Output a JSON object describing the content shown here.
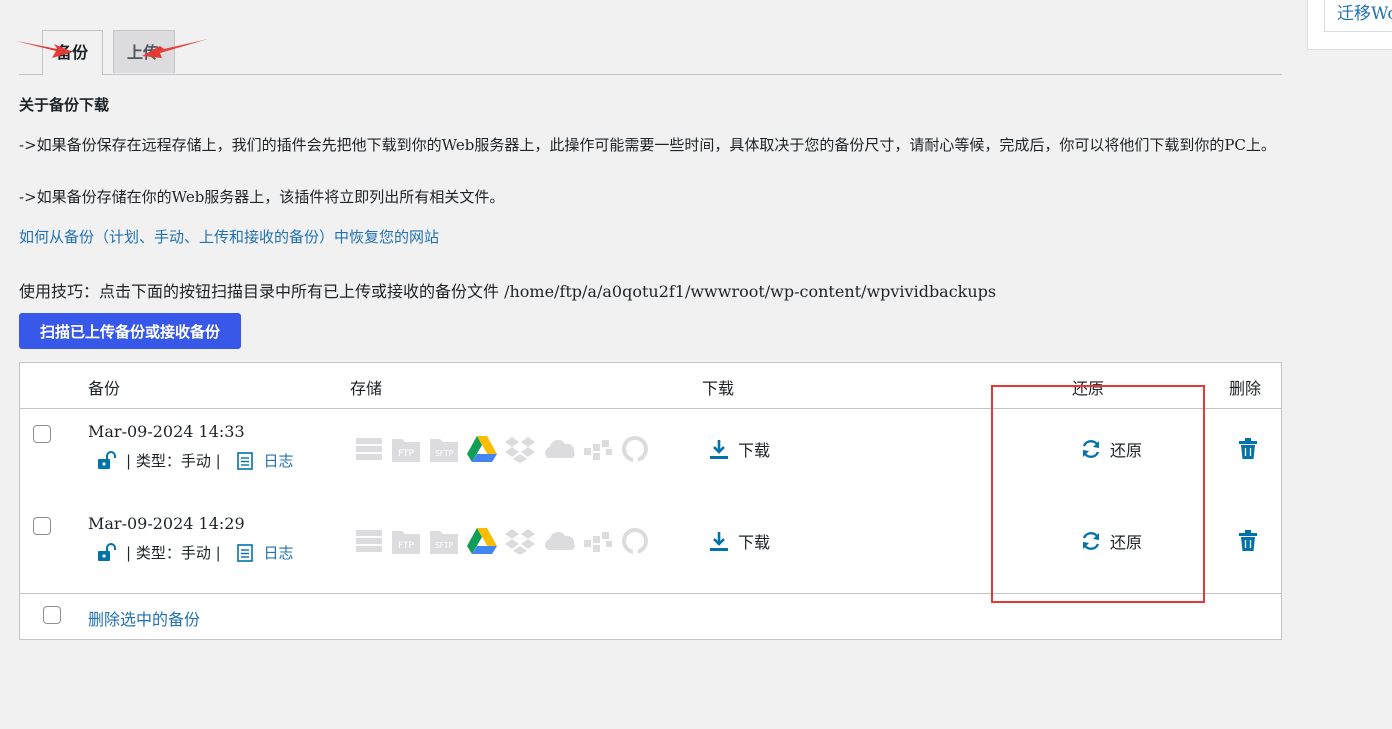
{
  "side": {
    "link": "迁移Wo"
  },
  "tabs": [
    {
      "label": "备份"
    },
    {
      "label": "上传"
    }
  ],
  "about": {
    "heading": "关于备份下载",
    "para1": "->如果备份保存在远程存储上，我们的插件会先把他下载到你的Web服务器上，此操作可能需要一些时间，具体取决于您的备份尺寸，请耐心等候，完成后，你可以将他们下载到你的PC上。",
    "para2": "->如果备份存储在你的Web服务器上，该插件将立即列出所有相关文件。",
    "howto_link": "如何从备份（计划、手动、上传和接收的备份）中恢复您的网站"
  },
  "tip": "使用技巧：点击下面的按钮扫描目录中所有已上传或接收的备份文件 /home/ftp/a/a0qotu2f1/wwwroot/wp-content/wpvividbackups",
  "scan_button": "扫描已上传备份或接收备份",
  "table": {
    "headers": {
      "backup": "备份",
      "storage": "存储",
      "download": "下载",
      "restore": "还原",
      "delete": "删除"
    },
    "rows": [
      {
        "date": "Mar-09-2024 14:33",
        "type": "| 类型：手动 |",
        "log": "日志",
        "download": "下载",
        "restore": "还原"
      },
      {
        "date": "Mar-09-2024 14:29",
        "type": "| 类型：手动 |",
        "log": "日志",
        "download": "下载",
        "restore": "还原"
      }
    ],
    "footer_action": "删除选中的备份"
  },
  "storage_icons": [
    "server-icon",
    "ftp-icon",
    "sftp-icon",
    "google-drive-icon",
    "dropbox-icon",
    "onedrive-icon",
    "s3-icon",
    "wasabi-icon"
  ],
  "colors": {
    "accent": "#2271b1",
    "button": "#3858e9",
    "highlight": "#e53935",
    "icon_active": "#0073aa"
  }
}
